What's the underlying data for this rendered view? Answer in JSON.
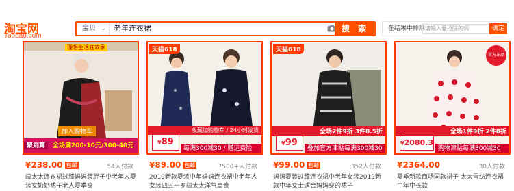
{
  "header": {
    "logo_cn": "淘宝网",
    "logo_en": "Taobao.com",
    "search_category": "宝贝",
    "search_query": "老年连衣裙",
    "search_button": "搜 索",
    "result_search_label": "在结果中排除",
    "result_search_placeholder": "请输入要排除的词",
    "result_search_button": "确定"
  },
  "products": [
    {
      "promo_top": "理想生活狂欢季",
      "bottom_promo": "全场满200-10元/300-40元",
      "overlay_1": "加入购物车",
      "overlay_2": "聚划算",
      "price": "¥238.00",
      "badge": "包邮",
      "paid": "54人付款",
      "title": "阔太太连衣裙过膝妈妈装胖子中老年人夏装女奶奶裙子老人夏季穿"
    },
    {
      "tag": "天猫618",
      "overlay_1": "收藏加购物车 / 24小时发货",
      "overlay_2": "89",
      "bottom_promo": "每满300减30 / 赠运费险",
      "price": "¥89.00",
      "badge": "包邮",
      "paid": "7500+人付款",
      "title": "2019新款夏装中年妈妈连衣裙中老年人女装四五十岁阔太太洋气高贵"
    },
    {
      "tag": "天猫618",
      "overlay_1": "全场2件9折 3件8.5折",
      "overlay_2": "99",
      "bottom_promo": "叠加官方津贴每满300减30",
      "price": "¥99.00",
      "badge": "包邮",
      "paid": "352人付款",
      "title": "妈妈夏装过膝连衣裙中老年女装2019新款中年女士适合妈妈穿的裙子"
    },
    {
      "tag": "官方正品",
      "overlay_1": "全场1件9折 2件8折",
      "overlay_2": "2080.3",
      "bottom_promo": "购物津贴每满300减30",
      "price": "¥2364.00",
      "badge": "",
      "paid": "30人付款",
      "title": "夏季新款商场同款裙子 太太雪纺连衣裙中年中长款"
    }
  ],
  "colors": {
    "brand": "#ff5000",
    "price": "#ff4400",
    "promo_red": "#e4192b"
  }
}
